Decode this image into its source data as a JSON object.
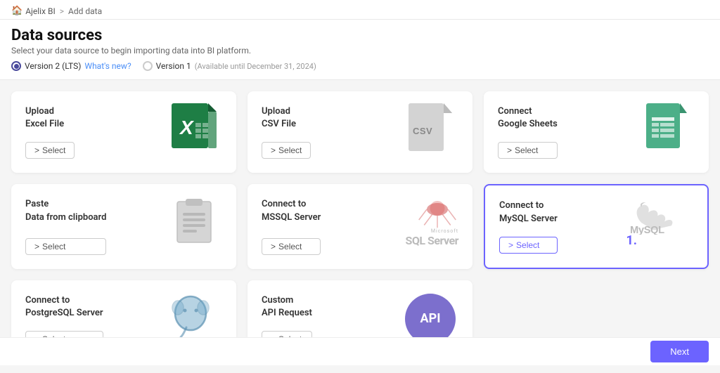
{
  "breadcrumb": {
    "home": "Ajelix BI",
    "separator": ">",
    "current": "Add data",
    "home_icon": "🏠"
  },
  "header": {
    "title": "Data sources",
    "subtitle": "Select your data source to begin importing data into BI platform.",
    "version2_label": "Version 2 (LTS)",
    "whats_new_label": "What's new?",
    "version1_label": "Version 1",
    "version1_note": "(Available until December 31, 2024)"
  },
  "cards": [
    {
      "id": "upload-excel",
      "title_line1": "Upload",
      "title_line2": "Excel File",
      "btn_label": "Select",
      "icon_type": "excel",
      "highlighted": false
    },
    {
      "id": "upload-csv",
      "title_line1": "Upload",
      "title_line2": "CSV File",
      "btn_label": "Select",
      "icon_type": "csv",
      "highlighted": false
    },
    {
      "id": "connect-sheets",
      "title_line1": "Connect",
      "title_line2": "Google Sheets",
      "btn_label": "Select",
      "icon_type": "sheets",
      "highlighted": false
    },
    {
      "id": "paste-clipboard",
      "title_line1": "Paste",
      "title_line2": "Data from clipboard",
      "btn_label": "Select",
      "icon_type": "clipboard",
      "highlighted": false
    },
    {
      "id": "connect-mssql",
      "title_line1": "Connect to",
      "title_line2": "MSSQL Server",
      "btn_label": "Select",
      "icon_type": "mssql",
      "highlighted": false
    },
    {
      "id": "connect-mysql",
      "title_line1": "Connect to",
      "title_line2": "MySQL Server",
      "btn_label": "Select",
      "icon_type": "mysql",
      "highlighted": true,
      "badge": "1."
    },
    {
      "id": "connect-postgres",
      "title_line1": "Connect to",
      "title_line2": "PostgreSQL Server",
      "btn_label": "Select",
      "icon_type": "postgres",
      "highlighted": false
    },
    {
      "id": "custom-api",
      "title_line1": "Custom",
      "title_line2": "API Request",
      "btn_label": "Select",
      "icon_type": "api",
      "highlighted": false
    }
  ],
  "bottom": {
    "next_label": "Next"
  },
  "colors": {
    "accent": "#6c63ff",
    "excel_green": "#1e7e45",
    "sheets_green": "#4caf88",
    "api_purple": "#7c6fcd"
  }
}
